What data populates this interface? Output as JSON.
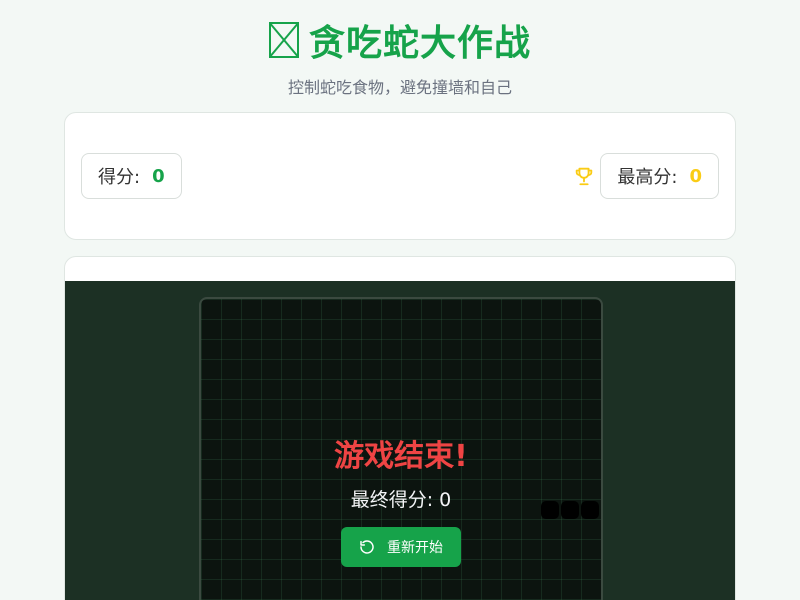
{
  "header": {
    "title": "贪吃蛇大作战",
    "subtitle": "控制蛇吃食物，避免撞墙和自己"
  },
  "scores": {
    "score_label": "得分:",
    "score_value": "0",
    "high_label": "最高分:",
    "high_value": "0"
  },
  "game_over": {
    "title": "游戏结束!",
    "final_label": "最终得分: 0",
    "restart_label": "重新开始"
  },
  "colors": {
    "accent": "#16a34a",
    "gold": "#facc15",
    "danger": "#ef4444"
  },
  "icons": [
    "broken-image-icon",
    "trophy-icon",
    "restart-icon"
  ]
}
